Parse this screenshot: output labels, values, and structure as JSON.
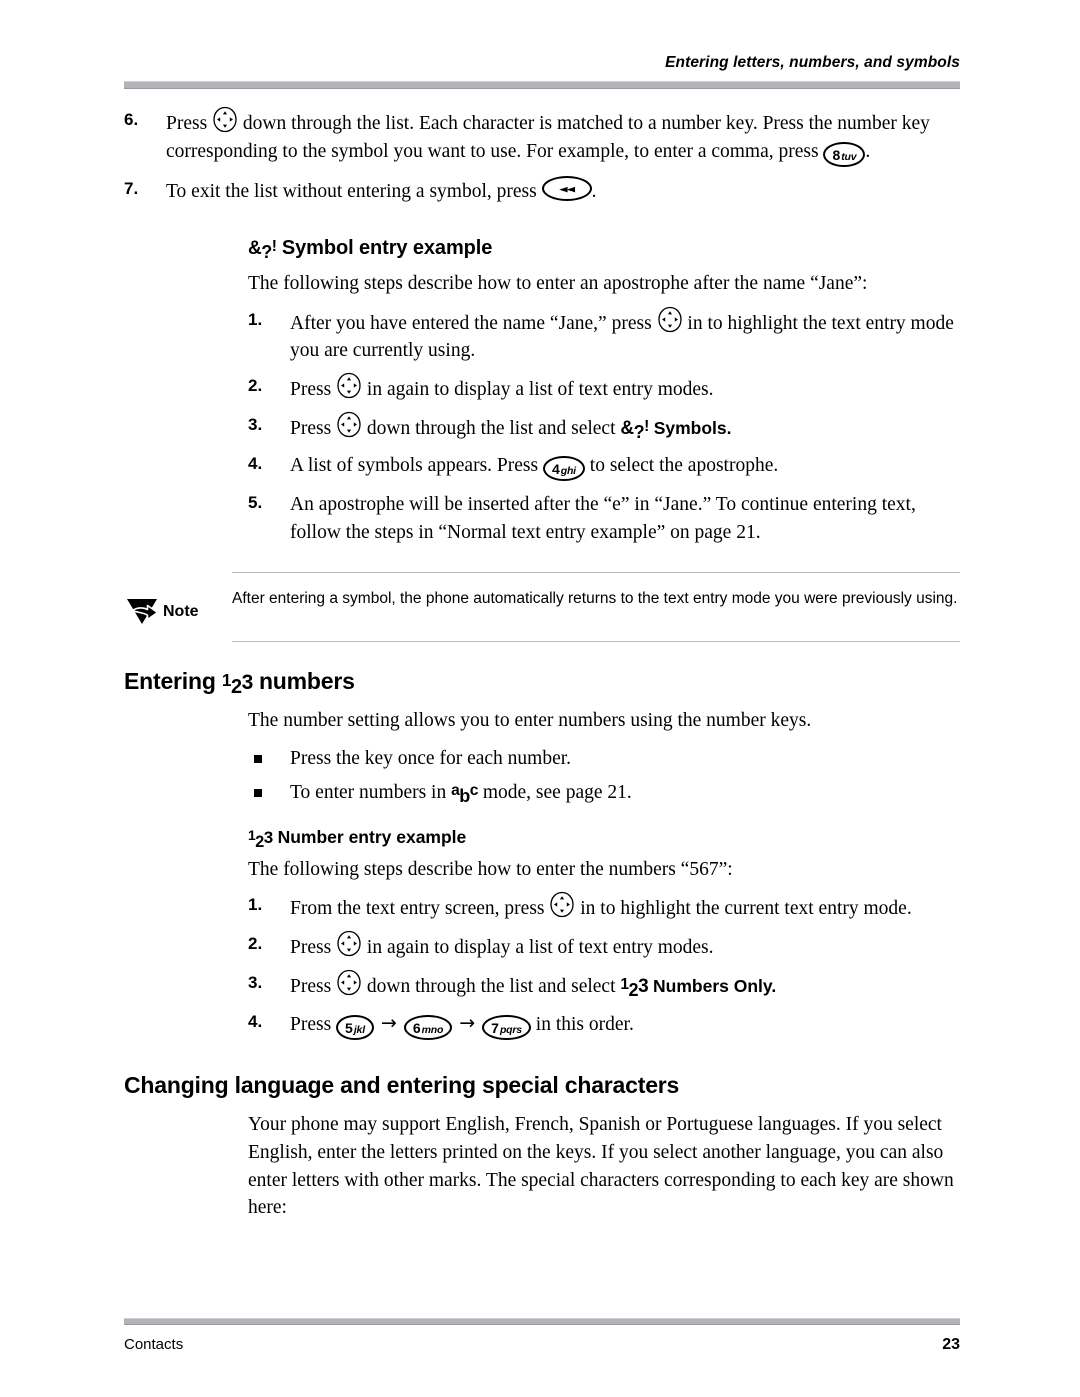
{
  "header": {
    "title": "Entering letters, numbers, and symbols"
  },
  "footer": {
    "left": "Contacts",
    "page_number": "23"
  },
  "top_steps": [
    {
      "num": "6.",
      "part1": "Press",
      "key1": "nav-key",
      "part2": "down through the list. Each character is matched to a number key. Press the number key corresponding to the symbol you want to use. For example, to enter a comma, press",
      "key2_number": "8",
      "key2_letters": "tuv",
      "part3": "."
    },
    {
      "num": "7.",
      "part1": "To exit the list without entering a symbol, press",
      "key1": "back-key",
      "part2": "."
    }
  ],
  "symbol_section": {
    "glyph": {
      "c1": "&",
      "c2": "?",
      "c3": "!"
    },
    "heading": "Symbol entry example",
    "intro": "The following steps describe how to enter an apostrophe after the name “Jane”:",
    "steps": [
      {
        "num": "1.",
        "part1": "After you have entered the name “Jane,” press",
        "part2": "in to highlight the text entry mode you are currently using."
      },
      {
        "num": "2.",
        "part1": "Press",
        "part2": "in again to display a list of text entry modes."
      },
      {
        "num": "3.",
        "part1": "Press",
        "part2": "down through the list and select",
        "bold_tail": "Symbols."
      },
      {
        "num": "4.",
        "part1": "A list of symbols appears. Press",
        "key_number": "4",
        "key_letters": "ghi",
        "part2": "to select the apostrophe."
      },
      {
        "num": "5.",
        "part1": "An apostrophe will be inserted after the “e” in “Jane.” To continue entering text, follow the steps in “Normal text entry example” on page 21."
      }
    ]
  },
  "note": {
    "icon": "note-arrow-icon",
    "label": "Note",
    "text": "After entering a symbol, the phone automatically returns to the text entry mode you were previously using."
  },
  "numbers_section": {
    "heading_before": "Entering",
    "heading_glyph": {
      "c1": "1",
      "c2": "2",
      "c3": "3"
    },
    "heading_after": "numbers",
    "intro": "The number setting allows you to enter numbers using the number keys.",
    "bullets": [
      {
        "text": "Press the key once for each number."
      },
      {
        "text_before": "To enter numbers in",
        "glyph": {
          "c1": "a",
          "c2": "b",
          "c3": "c"
        },
        "text_after": "mode, see page 21."
      }
    ],
    "example": {
      "glyph": {
        "c1": "1",
        "c2": "2",
        "c3": "3"
      },
      "heading": "Number entry example",
      "intro": "The following steps describe how to enter the numbers “567”:",
      "steps": [
        {
          "num": "1.",
          "part1": "From the text entry screen, press",
          "part2": "in to highlight the current text entry mode."
        },
        {
          "num": "2.",
          "part1": "Press",
          "part2": "in again to display a list of text entry modes."
        },
        {
          "num": "3.",
          "part1": "Press",
          "part2": "down through the list and select",
          "bold_tail": "Numbers Only."
        },
        {
          "num": "4.",
          "part1": "Press",
          "keys": [
            {
              "number": "5",
              "letters": "jkl"
            },
            {
              "number": "6",
              "letters": "mno"
            },
            {
              "number": "7",
              "letters": "pqrs"
            }
          ],
          "separator": "→",
          "part2": "in this order."
        }
      ]
    }
  },
  "language_section": {
    "heading": "Changing language and entering special characters",
    "paragraph": "Your phone may support English, French, Spanish or Portuguese languages. If you select English, enter the letters printed on the keys. If you select another language, you can also enter letters with other marks. The special characters corresponding to each key are shown here:"
  }
}
